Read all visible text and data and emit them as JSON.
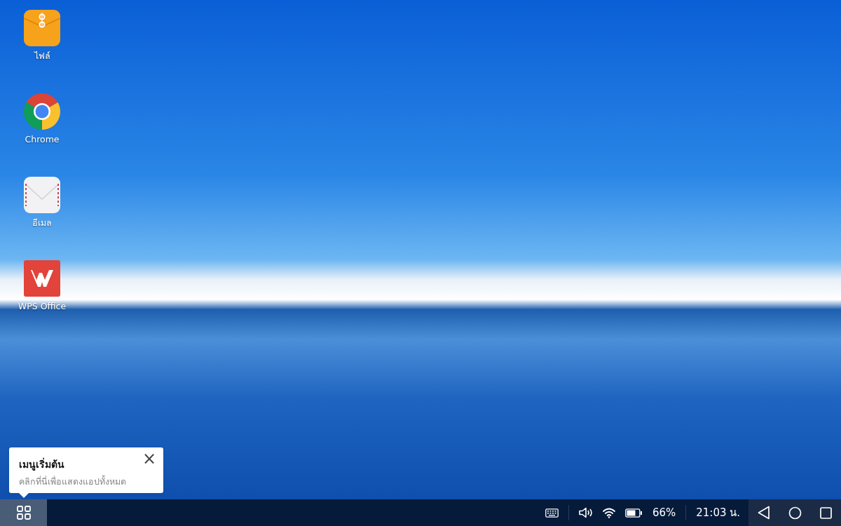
{
  "desktop_icons": [
    {
      "label": "ไฟล์",
      "kind": "files"
    },
    {
      "label": "Chrome",
      "kind": "chrome"
    },
    {
      "label": "อีเมล",
      "kind": "email"
    },
    {
      "label": "WPS Office",
      "kind": "wps"
    }
  ],
  "tooltip": {
    "title": "เมนูเริ่มต้น",
    "text": "คลิกที่นี่เพื่อแสดงแอปทั้งหมด",
    "close": "×"
  },
  "taskbar": {
    "start_selected": true,
    "battery": "66%",
    "clock": "21:03 น."
  }
}
